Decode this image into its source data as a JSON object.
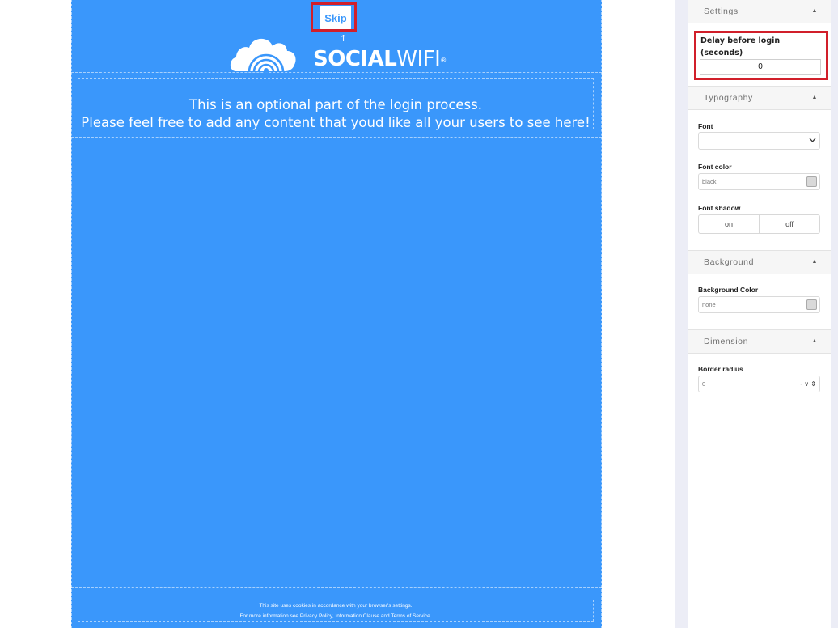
{
  "preview": {
    "skip_label": "Skip",
    "move_arrow": "↑",
    "logo": {
      "bold": "SOCIAL",
      "regular": "WIFI",
      "mark": "®"
    },
    "content_lines": [
      "This is an optional part of the login process.",
      "Please feel free to add any content that youd like all your users to see here!"
    ],
    "footer_lines": [
      "This site uses cookies in accordance with your browser's settings.",
      "For more information see Privacy Policy, Information Clause and Terms of Service."
    ],
    "background_color": "#3a97fb"
  },
  "panel": {
    "settings": {
      "title": "Settings",
      "delay_label": "Delay before login (seconds)",
      "delay_value": "0"
    },
    "typography": {
      "title": "Typography",
      "font_label": "Font",
      "font_value": "",
      "font_color_label": "Font color",
      "font_color_value": "black",
      "font_shadow_label": "Font shadow",
      "shadow_on": "on",
      "shadow_off": "off"
    },
    "background": {
      "title": "Background",
      "color_label": "Background Color",
      "color_value": "none"
    },
    "dimension": {
      "title": "Dimension",
      "radius_label": "Border radius",
      "radius_value": "0",
      "radius_unit": "-"
    }
  },
  "icons": {
    "collapse": "caret-up-icon",
    "dropdown": "chevron-down-icon",
    "logo": "cloud-wifi-logo-icon"
  },
  "highlight_color": "#d11f2a"
}
